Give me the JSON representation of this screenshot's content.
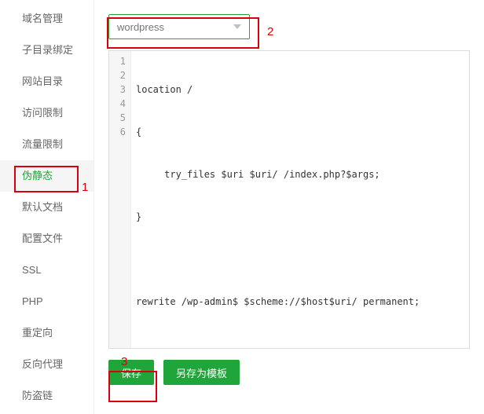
{
  "sidebar": {
    "items": [
      {
        "label": "域名管理"
      },
      {
        "label": "子目录绑定"
      },
      {
        "label": "网站目录"
      },
      {
        "label": "访问限制"
      },
      {
        "label": "流量限制"
      },
      {
        "label": "伪静态",
        "active": true
      },
      {
        "label": "默认文档"
      },
      {
        "label": "配置文件"
      },
      {
        "label": "SSL"
      },
      {
        "label": "PHP"
      },
      {
        "label": "重定向"
      },
      {
        "label": "反向代理"
      },
      {
        "label": "防盗链"
      }
    ]
  },
  "dropdown": {
    "selected": "wordpress"
  },
  "editor": {
    "lines": [
      "location /",
      "{",
      "     try_files $uri $uri/ /index.php?$args;",
      "}",
      "",
      "rewrite /wp-admin$ $scheme://$host$uri/ permanent;"
    ]
  },
  "buttons": {
    "save": "保存",
    "save_as_template": "另存为模板"
  },
  "annotations": {
    "label1": "1",
    "label2": "2",
    "label3": "3"
  }
}
